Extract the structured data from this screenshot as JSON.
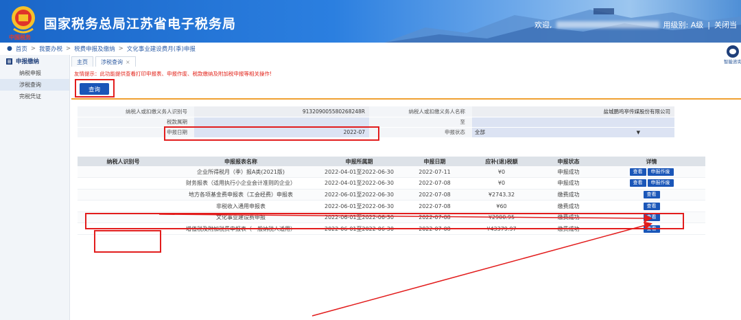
{
  "header": {
    "emblem_sub": "中国税务",
    "title": "国家税务总局江苏省电子税务局",
    "greeting": "欢迎,",
    "user_level": "用级别: A级",
    "sep": "|",
    "close_label": "关闭当"
  },
  "breadcrumb": {
    "items": [
      "首页",
      "我要办税",
      "税费申报及缴纳",
      "文化事业建设费月(季)申报"
    ],
    "sep": ">"
  },
  "sidebar": {
    "head": "申报缴纳",
    "items": [
      "纳税申报",
      "涉税查询",
      "完税凭证"
    ]
  },
  "tabs": {
    "home": "主页",
    "query": "涉税查询",
    "close": "×"
  },
  "tip": "友情提示：此功能提供查看打印申报表、申报作废、税款缴纳及附加税申报等相关操作!",
  "query_button": "查询",
  "form": {
    "taxpayer_id_label": "纳税人或扣缴义务人识别号",
    "taxpayer_id_value": "913209005580268248R",
    "taxpayer_name_label": "纳税人或扣缴义务人名称",
    "taxpayer_name_value": "盐城鹏鸣亭传媒股份有限公司",
    "tax_period_label": "税款属期",
    "to_label": "至",
    "report_date_label": "申报日期",
    "report_date_value": "2022-07",
    "status_label": "申报状态",
    "status_value": "全部",
    "status_arrow": "▼"
  },
  "table": {
    "headers": [
      "纳税人识别号",
      "申报报表名称",
      "申报所属期",
      "申报日期",
      "应补(退)税额",
      "申报状态",
      "详情"
    ],
    "rows": [
      {
        "name": "企业所得税月（季）报A类(2021版)",
        "period": "2022-04-01至2022-06-30",
        "date": "2022-07-11",
        "amount": "¥0",
        "status": "申报成功",
        "btn1": "查看",
        "btn2": "申报作废"
      },
      {
        "name": "财务报表（适用执行小企业会计准则的企业）",
        "period": "2022-04-01至2022-06-30",
        "date": "2022-07-08",
        "amount": "¥0",
        "status": "申报成功",
        "btn1": "查看",
        "btn2": "申报作废"
      },
      {
        "name": "地方各项基金费申报表（工会经费）申报表",
        "period": "2022-06-01至2022-06-30",
        "date": "2022-07-08",
        "amount": "¥2743.32",
        "status": "缴费成功",
        "btn1": "查看",
        "btn2": ""
      },
      {
        "name": "非税收入通用申报表",
        "period": "2022-06-01至2022-06-30",
        "date": "2022-07-08",
        "amount": "¥60",
        "status": "缴费成功",
        "btn1": "查看",
        "btn2": ""
      },
      {
        "name": "文化事业建设费申报",
        "period": "2022-06-01至2022-06-30",
        "date": "2022-07-08",
        "amount": "¥2900.95",
        "status": "缴费成功",
        "btn1": "查看",
        "btn2": ""
      },
      {
        "name": "增值税及附加税费申报表（一般纳税人适用）",
        "period": "2022-06-01至2022-06-30",
        "date": "2022-07-08",
        "amount": "¥43379.97",
        "status": "缴费成功",
        "btn1": "查看",
        "btn2": ""
      }
    ]
  },
  "assistant": {
    "label": "智能咨询"
  },
  "colors": {
    "primary": "#1a56b8",
    "accent": "#f0a030",
    "annotation": "#e21c1c"
  }
}
